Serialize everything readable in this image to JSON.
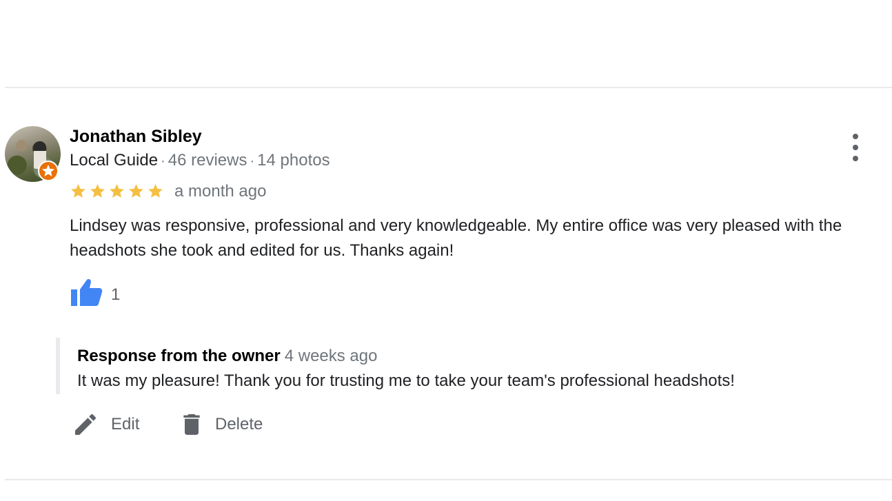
{
  "review": {
    "author": "Jonathan Sibley",
    "guide_label": "Local Guide",
    "reviews_count": "46 reviews",
    "photos_count": "14 photos",
    "separator": "·",
    "rating": 5,
    "max_rating": 5,
    "time": "a month ago",
    "text": "Lindsey was responsive, professional and very knowledgeable. My entire office was very pleased with the headshots she took and edited for us. Thanks again!",
    "likes": "1"
  },
  "owner_response": {
    "label": "Response from the owner",
    "time": "4 weeks ago",
    "text": "It was my pleasure! Thank you for trusting me to take your team's professional headshots!"
  },
  "actions": {
    "edit_label": "Edit",
    "delete_label": "Delete"
  },
  "icons": {
    "avatar": "avatar",
    "badge": "local-guide-star-icon",
    "more": "more-vert-icon",
    "star": "star-icon",
    "like": "thumbs-up-icon",
    "edit": "pencil-icon",
    "delete": "trash-icon"
  },
  "colors": {
    "star": "#f4bf42",
    "like": "#4285f4",
    "badge": "#e8710a",
    "secondary_text": "#70757a",
    "icon_gray": "#5f6368"
  }
}
